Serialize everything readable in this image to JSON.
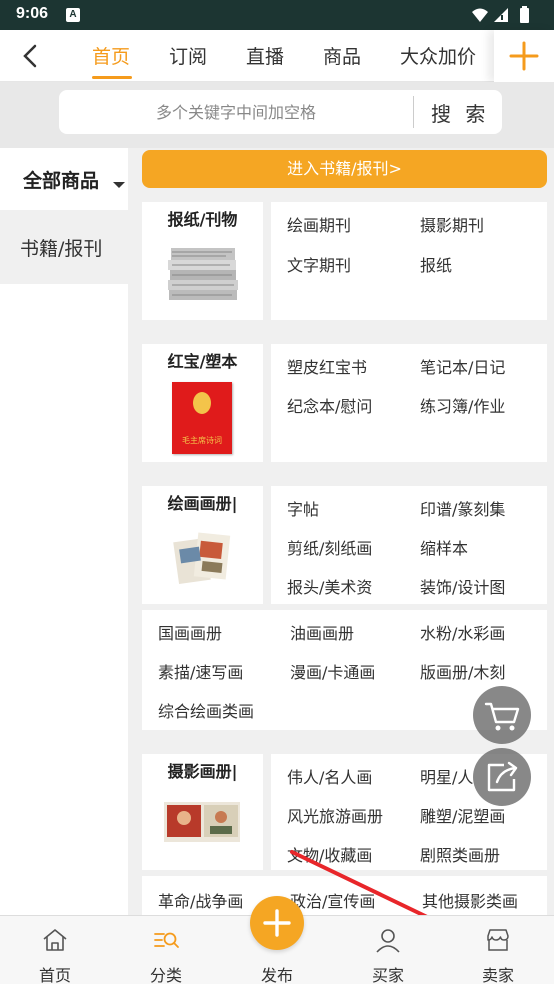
{
  "status_bar": {
    "time": "9:06",
    "app_badge": "A"
  },
  "top_nav": {
    "tabs": [
      "首页",
      "订阅",
      "直播",
      "商品",
      "大众加价"
    ],
    "active_tab": 0
  },
  "search": {
    "placeholder": "多个关键字中间加空格",
    "button_label": "搜 索"
  },
  "left_categories": {
    "header": "全部商品",
    "items": [
      "书籍/报刊"
    ]
  },
  "enter_button": "进入书籍/报刊>",
  "sections": [
    {
      "title": "报纸/刊物",
      "links": [
        "绘画期刊",
        "摄影期刊",
        "文字期刊",
        "报纸"
      ],
      "extra": []
    },
    {
      "title": "红宝/塑本",
      "links": [
        "塑皮红宝书",
        "笔记本/日记",
        "纪念本/慰问",
        "练习簿/作业"
      ],
      "extra": []
    },
    {
      "title": "绘画画册|",
      "links": [
        "字帖",
        "印谱/篆刻集",
        "剪纸/刻纸画",
        "缩样本",
        "报头/美术资",
        "装饰/设计图"
      ],
      "extra": [
        "国画画册",
        "油画画册",
        "水粉/水彩画",
        "素描/速写画",
        "漫画/卡通画",
        "版画册/木刻",
        "综合绘画类画"
      ]
    },
    {
      "title": "摄影画册|",
      "links": [
        "伟人/名人画",
        "明星/人",
        "风光旅游画册",
        "雕塑/泥塑画",
        "文物/收藏画",
        "剧照类画册"
      ],
      "extra": [
        "革命/战争画",
        "政治/宣传画",
        "其他摄影类画"
      ]
    }
  ],
  "book_cover_text": "毛主席诗词",
  "bottom_nav": {
    "items": [
      "首页",
      "分类",
      "发布",
      "买家",
      "卖家"
    ]
  },
  "colors": {
    "accent": "#f59b1c",
    "status_bar": "#1c3532",
    "arrow": "#e8262a"
  }
}
